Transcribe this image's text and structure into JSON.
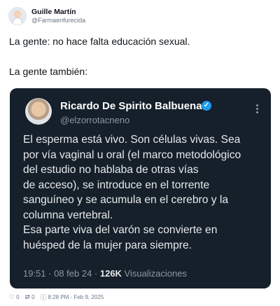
{
  "author": {
    "name": "Guille Martín",
    "handle": "@Farmaenfurecida"
  },
  "tweet": {
    "line1": "La gente: no hace falta educación sexual.",
    "line2": "La gente también:"
  },
  "embed": {
    "name": "Ricardo De Spirito Balbuena.",
    "handle": "@elzorrotacneno",
    "lines": [
      "El esperma está vivo. Son células vivas. Sea",
      "por vía vaginal u oral (el marco metodológico",
      "del estudio no hablaba de otras vías",
      "de acceso), se introduce en el torrente",
      "sanguíneo y se acumula en el cerebro y la",
      "columna vertebral.",
      "Esa parte viva del varón se convierte en",
      "huésped de la mujer para siempre."
    ],
    "timestamp": "19:51 · 08 feb 24 · ",
    "views": "126K",
    "views_label": " Visualizaciones"
  },
  "footer": {
    "likes": "0",
    "retweets": "0",
    "time": "8:28 PM - Feb 9, 2025"
  },
  "colors": {
    "embed_bg": "#15202b",
    "verified": "#1d9bf0"
  }
}
